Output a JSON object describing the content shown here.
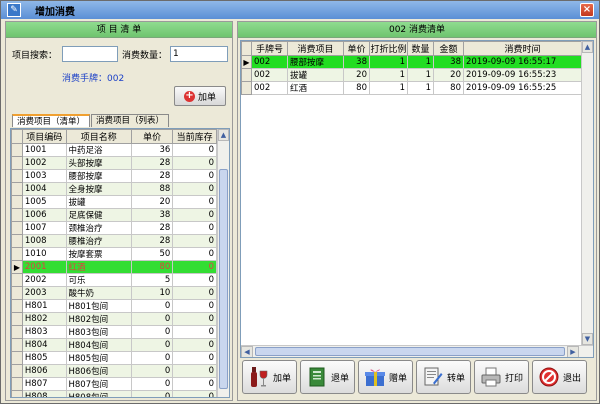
{
  "window": {
    "title": "增加消费",
    "close_glyph": "×",
    "icon": "app-icon"
  },
  "left": {
    "header": "项 目 清 单",
    "search_label": "项目搜索：",
    "search_value": "",
    "qty_label": "消费数量：",
    "qty_value": "1",
    "handcard_label": "消费手牌：002",
    "add_button": "加单",
    "tabs": [
      "消费项目（清单）",
      "消费项目（列表）"
    ],
    "columns": [
      "项目编码",
      "项目名称",
      "单价",
      "当前库存"
    ],
    "rows": [
      [
        "1001",
        "中药足浴",
        "36",
        "0"
      ],
      [
        "1002",
        "头部按摩",
        "28",
        "0"
      ],
      [
        "1003",
        "腰部按摩",
        "28",
        "0"
      ],
      [
        "1004",
        "全身按摩",
        "88",
        "0"
      ],
      [
        "1005",
        "拔罐",
        "20",
        "0"
      ],
      [
        "1006",
        "足底保健",
        "38",
        "0"
      ],
      [
        "1007",
        "颈椎治疗",
        "28",
        "0"
      ],
      [
        "1008",
        "腰椎治疗",
        "28",
        "0"
      ],
      [
        "1010",
        "按摩套票",
        "50",
        "0"
      ],
      [
        "2001",
        "红酒",
        "80",
        "0"
      ],
      [
        "2002",
        "可乐",
        "5",
        "0"
      ],
      [
        "2003",
        "酸牛奶",
        "10",
        "0"
      ],
      [
        "H801",
        "H801包间",
        "0",
        "0"
      ],
      [
        "H802",
        "H802包间",
        "0",
        "0"
      ],
      [
        "H803",
        "H803包间",
        "0",
        "0"
      ],
      [
        "H804",
        "H804包间",
        "0",
        "0"
      ],
      [
        "H805",
        "H805包间",
        "0",
        "0"
      ],
      [
        "H806",
        "H806包间",
        "0",
        "0"
      ],
      [
        "H807",
        "H807包间",
        "0",
        "0"
      ],
      [
        "H808",
        "H808包间",
        "0",
        "0"
      ]
    ],
    "selected_row": 9,
    "row_indicator": "▶"
  },
  "right": {
    "header": "002  消费清单",
    "columns": [
      "手牌号",
      "消费项目",
      "单价",
      "打折比例",
      "数量",
      "金额",
      "消费时间"
    ],
    "rows": [
      [
        "002",
        "腰部按摩",
        "38",
        "1",
        "1",
        "38",
        "2019-09-09 16:55:17"
      ],
      [
        "002",
        "拔罐",
        "20",
        "1",
        "1",
        "20",
        "2019-09-09 16:55:23"
      ],
      [
        "002",
        "红酒",
        "80",
        "1",
        "1",
        "80",
        "2019-09-09 16:55:25"
      ]
    ],
    "row_indicator": "▶"
  },
  "toolbar": {
    "add": "加单",
    "refund": "退单",
    "gift": "赠单",
    "transfer": "转单",
    "print": "打印",
    "exit": "退出"
  },
  "scroll_glyphs": {
    "up": "▲",
    "down": "▼",
    "left": "◀",
    "right": "▶"
  }
}
